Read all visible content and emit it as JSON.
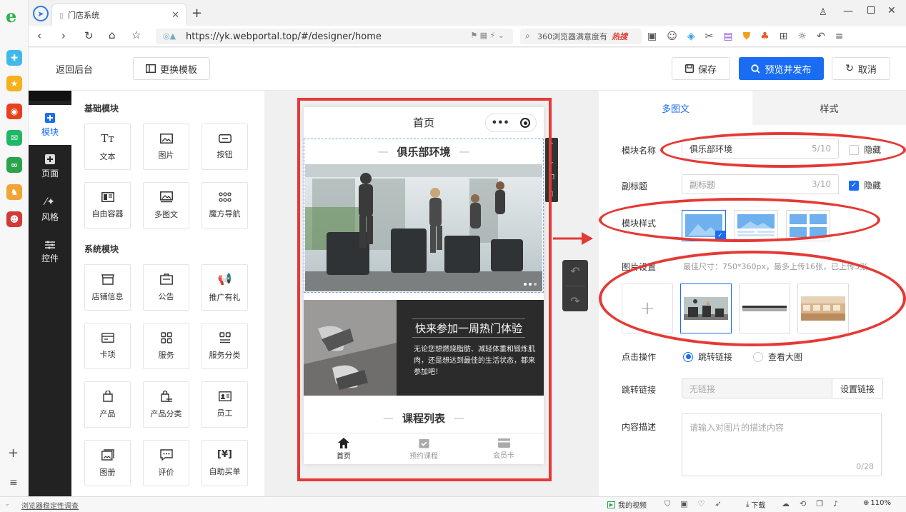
{
  "browser": {
    "tab_title": "门店系统",
    "url": "https://yk.webportal.top/#/designer/home",
    "search_text": "360浏览器满意度有",
    "hot_label": "热搜"
  },
  "header": {
    "back_label": "返回后台",
    "change_template_label": "更换模板",
    "save_label": "保存",
    "preview_publish_label": "预览并发布",
    "cancel_label": "取消"
  },
  "left_nav": {
    "items": [
      {
        "label": "模块",
        "icon": "plus-square-icon"
      },
      {
        "label": "页面",
        "icon": "page-plus-icon"
      },
      {
        "label": "风格",
        "icon": "magic-wand-icon"
      },
      {
        "label": "控件",
        "icon": "sliders-icon"
      }
    ]
  },
  "modules": {
    "basic_title": "基础模块",
    "basic": [
      {
        "label": "文本",
        "icon": "text-icon"
      },
      {
        "label": "图片",
        "icon": "image-icon"
      },
      {
        "label": "按钮",
        "icon": "button-icon"
      },
      {
        "label": "自由容器",
        "icon": "container-icon"
      },
      {
        "label": "多图文",
        "icon": "multi-image-icon"
      },
      {
        "label": "魔方导航",
        "icon": "grid-dots-icon"
      }
    ],
    "system_title": "系统模块",
    "system": [
      {
        "label": "店铺信息",
        "icon": "store-icon"
      },
      {
        "label": "公告",
        "icon": "notice-icon"
      },
      {
        "label": "推广有礼",
        "icon": "megaphone-icon"
      },
      {
        "label": "卡项",
        "icon": "card-icon"
      },
      {
        "label": "服务",
        "icon": "service-grid-icon"
      },
      {
        "label": "服务分类",
        "icon": "service-category-icon"
      },
      {
        "label": "产品",
        "icon": "bag-icon"
      },
      {
        "label": "产品分类",
        "icon": "bag-category-icon"
      },
      {
        "label": "员工",
        "icon": "staff-card-icon"
      },
      {
        "label": "图册",
        "icon": "album-icon"
      },
      {
        "label": "评价",
        "icon": "comment-icon"
      },
      {
        "label": "自助买单",
        "icon": "scan-pay-icon"
      }
    ]
  },
  "phone": {
    "title": "首页",
    "section_title": "俱乐部环境",
    "promo_title": "快来参加一周热门体验",
    "promo_text": "无论您想燃烧脂肪、减轻体重和锻炼肌肉，还是想达到最佳的生活状态，都来参加吧！",
    "course_title": "课程列表",
    "tabbar": [
      {
        "label": "首页",
        "icon": "home-icon"
      },
      {
        "label": "预约课程",
        "icon": "calendar-check-icon"
      },
      {
        "label": "会员卡",
        "icon": "member-card-icon"
      }
    ]
  },
  "right_panel": {
    "tabs": [
      "多图文",
      "样式"
    ],
    "module_name_label": "模块名称",
    "module_name_value": "俱乐部环境",
    "module_name_count": "5/10",
    "hide_label": "隐藏",
    "subtitle_label": "副标题",
    "subtitle_placeholder": "副标题",
    "subtitle_count": "3/10",
    "module_style_label": "模块样式",
    "image_settings_label": "图片设置",
    "image_settings_hint": "最佳尺寸：750*360px，最多上传16张，已上传3张",
    "click_action_label": "点击操作",
    "option_jump": "跳转链接",
    "option_view": "查看大图",
    "jump_link_label": "跳转链接",
    "jump_link_value": "无链接",
    "set_link_label": "设置链接",
    "desc_label": "内容描述",
    "desc_placeholder": "请输入对图片的描述内容",
    "desc_count": "0/28"
  },
  "statusbar": {
    "left_text": "浏览器稳定性调查",
    "video_label": "我的视频",
    "download_label": "下载",
    "zoom": "110%"
  },
  "colors": {
    "accent": "#1a6df2",
    "annotation_red": "#e53935",
    "dark_nav": "#222222"
  }
}
